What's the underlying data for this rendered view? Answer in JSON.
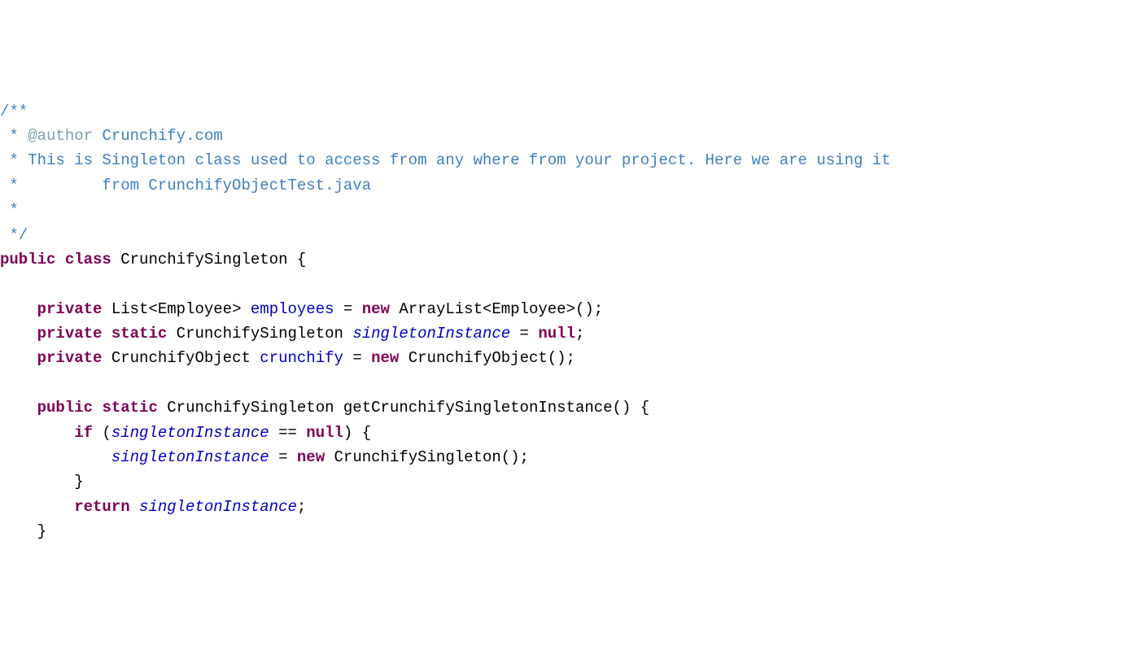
{
  "lines": {
    "l1_open": "/**",
    "l2_star": " * ",
    "l2_tag": "@author",
    "l2_rest": " Crunchify.com",
    "l3": " * This is Singleton class used to access from any where from your project. Here we are using it",
    "l4": " *         from CrunchifyObjectTest.java",
    "l5": " *",
    "l6": " */",
    "l7_kw1": "public",
    "l7_kw2": "class",
    "l7_name": "CrunchifySingleton",
    "l7_brace": "{",
    "l8": "",
    "l9_indent": "    ",
    "l9_kw": "private",
    "l9_type": "List<Employee>",
    "l9_field": "employees",
    "l9_eq": " = ",
    "l9_new": "new",
    "l9_ctor": " ArrayList<Employee>();",
    "l10_indent": "    ",
    "l10_kw1": "private",
    "l10_kw2": "static",
    "l10_type": "CrunchifySingleton",
    "l10_field": "singletonInstance",
    "l10_eq": " = ",
    "l10_null": "null",
    "l10_semi": ";",
    "l11_indent": "    ",
    "l11_kw": "private",
    "l11_type": "CrunchifyObject",
    "l11_field": "crunchify",
    "l11_eq": " = ",
    "l11_new": "new",
    "l11_ctor": " CrunchifyObject();",
    "l12": "",
    "l13_indent": "    ",
    "l13_kw1": "public",
    "l13_kw2": "static",
    "l13_type": "CrunchifySingleton",
    "l13_method": "getCrunchifySingletonInstance()",
    "l13_brace": "{",
    "l14_indent": "        ",
    "l14_if": "if",
    "l14_open": " (",
    "l14_field": "singletonInstance",
    "l14_op": " == ",
    "l14_null": "null",
    "l14_close": ") {",
    "l15_indent": "            ",
    "l15_field": "singletonInstance",
    "l15_eq": " = ",
    "l15_new": "new",
    "l15_ctor": " CrunchifySingleton();",
    "l16": "        }",
    "l17_indent": "        ",
    "l17_return": "return",
    "l17_sp": " ",
    "l17_field": "singletonInstance",
    "l17_semi": ";",
    "l18": "    }"
  }
}
